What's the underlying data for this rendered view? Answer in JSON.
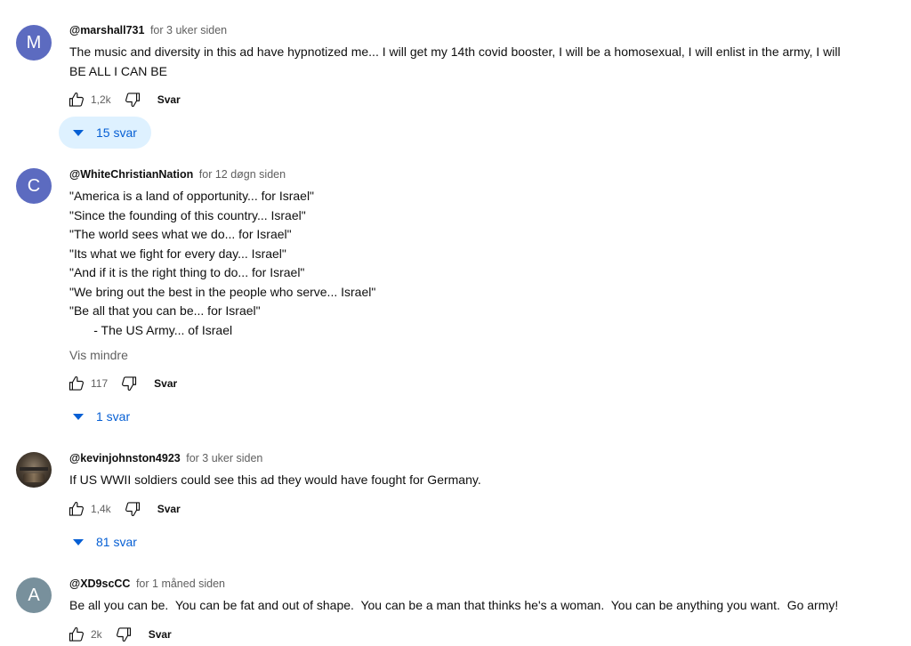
{
  "comments": [
    {
      "avatar_letter": "M",
      "avatar_color": "#5c6bc0",
      "author": "@marshall731",
      "time": "for 3 uker siden",
      "lines": [
        "The music and diversity in this ad have hypnotized me... I will get my 14th covid booster, I will be a homosexual, I will enlist in the army, I will",
        "BE ALL I CAN BE"
      ],
      "likes": "1,2k",
      "reply_label": "Svar",
      "replies_label": "15 svar"
    },
    {
      "avatar_letter": "C",
      "avatar_color": "#5c6bc0",
      "author": "@WhiteChristianNation",
      "time": "for 12 døgn siden",
      "lines": [
        "\"America is a land of opportunity... for Israel\"",
        "\"Since the founding of this country... Israel\"",
        "\"The world sees what we do... for Israel\"",
        "\"Its what we fight for every day... Israel\"",
        "\"And if it is the right thing to do... for Israel\"",
        "\"We bring out the best in the people who serve... Israel\"",
        "\"Be all that you can be... for Israel\"",
        "       - The US Army... of Israel"
      ],
      "show_less": "Vis mindre",
      "likes": "117",
      "reply_label": "Svar",
      "replies_label": "1 svar"
    },
    {
      "author": "@kevinjohnston4923",
      "time": "for 3 uker siden",
      "lines": [
        "If US WWII soldiers could see this ad they would have fought for Germany."
      ],
      "likes": "1,4k",
      "reply_label": "Svar",
      "replies_label": "81 svar"
    },
    {
      "avatar_letter": "A",
      "avatar_color": "#78909c",
      "author": "@XD9scCC",
      "time": "for 1 måned siden",
      "lines": [
        "Be all you can be.  You can be fat and out of shape.  You can be a man that thinks he's a woman.  You can be anything you want.  Go army!"
      ],
      "likes": "2k",
      "reply_label": "Svar"
    }
  ],
  "icons": {
    "like": "thumbs-up-icon",
    "dislike": "thumbs-down-icon",
    "expand": "caret-down-icon"
  },
  "colors": {
    "link": "#065fd4",
    "replies_hover_bg": "#def1ff",
    "muted": "#606060"
  }
}
